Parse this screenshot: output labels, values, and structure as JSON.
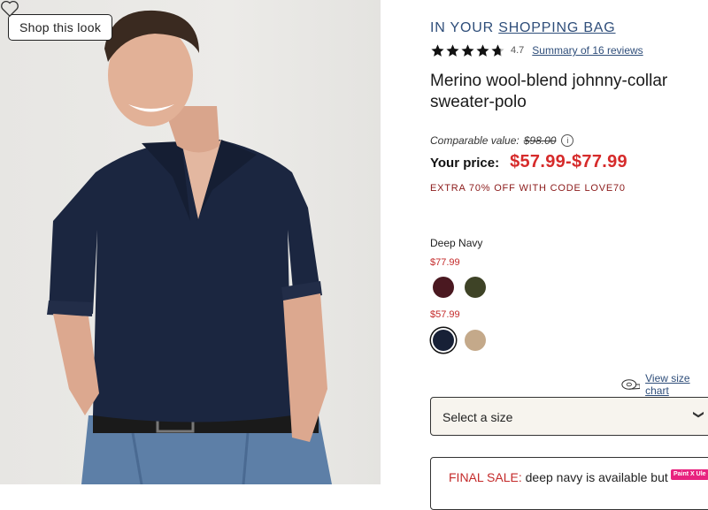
{
  "image_panel": {
    "shop_look_label": "Shop this look"
  },
  "product": {
    "bag_prefix": "IN YOUR ",
    "bag_link": "SHOPPING BAG",
    "rating_value": "4.7",
    "rating_fraction": 0.94,
    "reviews_link": "Summary of 16 reviews",
    "title": "Merino wool-blend johnny-collar sweater-polo",
    "comparable_label": "Comparable value:",
    "comparable_price": "$98.00",
    "info_glyph": "i",
    "price_label": "Your price:",
    "price_range": "$57.99-$77.99",
    "promo": "EXTRA 70% OFF WITH CODE LOVE70"
  },
  "colors": {
    "selected_name": "Deep Navy",
    "groups": [
      {
        "price": "$77.99",
        "swatches": [
          {
            "name": "burgundy",
            "hex": "#4a1820",
            "selected": false
          },
          {
            "name": "olive",
            "hex": "#3e4326",
            "selected": false
          }
        ]
      },
      {
        "price": "$57.99",
        "swatches": [
          {
            "name": "deep-navy",
            "hex": "#172036",
            "selected": true
          },
          {
            "name": "oatmeal",
            "hex": "#c4a98a",
            "selected": false
          }
        ]
      }
    ]
  },
  "size": {
    "chart_link": "View size chart",
    "select_placeholder": "Select a size",
    "chevron": "❯"
  },
  "final_sale": {
    "label": "FINAL SALE:",
    "text": " deep navy is available but",
    "badge": "Paint X Ule"
  },
  "accent_colors": {
    "link": "#2f4e7a",
    "price_red": "#d62b2b",
    "promo": "#8b1a1a"
  }
}
